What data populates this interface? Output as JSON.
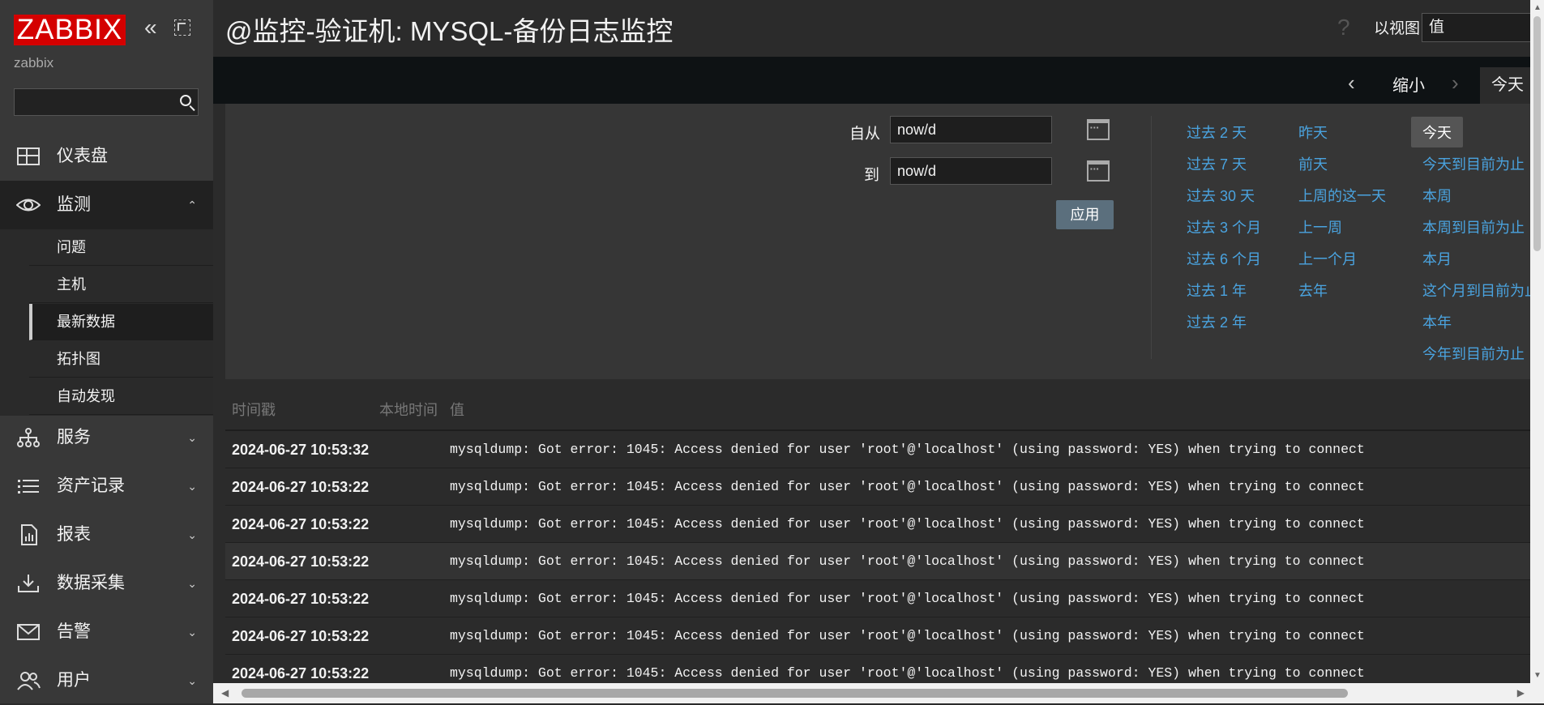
{
  "sidebar": {
    "logo": "ZABBIX",
    "server_name": "zabbix",
    "search_placeholder": "",
    "menu": [
      {
        "label": "仪表盘",
        "icon": "dashboard-icon"
      },
      {
        "label": "监测",
        "icon": "eye-icon",
        "expanded": true
      },
      {
        "label": "服务",
        "icon": "services-icon"
      },
      {
        "label": "资产记录",
        "icon": "list-icon"
      },
      {
        "label": "报表",
        "icon": "report-icon"
      },
      {
        "label": "数据采集",
        "icon": "download-icon"
      },
      {
        "label": "告警",
        "icon": "mail-icon"
      },
      {
        "label": "用户",
        "icon": "users-icon"
      }
    ],
    "submenu": [
      "问题",
      "主机",
      "最新数据",
      "拓扑图",
      "自动发现"
    ],
    "submenu_selected": "最新数据"
  },
  "header": {
    "title": "@监控-验证机: MYSQL-备份日志监控",
    "view_as_label": "以视图",
    "view_as_value": "值"
  },
  "filter_tabs": {
    "zoom_out": "缩小",
    "active_tab": "今天"
  },
  "filter": {
    "from_label": "自从",
    "from_value": "now/d",
    "to_label": "到",
    "to_value": "now/d",
    "apply_label": "应用",
    "quick_col1": [
      "过去 2 天",
      "过去 7 天",
      "过去 30 天",
      "过去 3 个月",
      "过去 6 个月",
      "过去 1 年",
      "过去 2 年"
    ],
    "quick_col2": [
      "昨天",
      "前天",
      "上周的这一天",
      "上一周",
      "上一个月",
      "去年"
    ],
    "quick_col3": [
      "今天",
      "今天到目前为止",
      "本周",
      "本周到目前为止",
      "本月",
      "这个月到目前为止",
      "本年",
      "今年到目前为止"
    ]
  },
  "table": {
    "headers": [
      "时间戳",
      "本地时间",
      "值"
    ],
    "rows": [
      {
        "timestamp": "2024-06-27 10:53:32",
        "value": "mysqldump: Got error: 1045: Access denied for user 'root'@'localhost' (using password: YES) when trying to connect"
      },
      {
        "timestamp": "2024-06-27 10:53:22",
        "value": "mysqldump: Got error: 1045: Access denied for user 'root'@'localhost' (using password: YES) when trying to connect"
      },
      {
        "timestamp": "2024-06-27 10:53:22",
        "value": "mysqldump: Got error: 1045: Access denied for user 'root'@'localhost' (using password: YES) when trying to connect"
      },
      {
        "timestamp": "2024-06-27 10:53:22",
        "value": "mysqldump: Got error: 1045: Access denied for user 'root'@'localhost' (using password: YES) when trying to connect"
      },
      {
        "timestamp": "2024-06-27 10:53:22",
        "value": "mysqldump: Got error: 1045: Access denied for user 'root'@'localhost' (using password: YES) when trying to connect"
      },
      {
        "timestamp": "2024-06-27 10:53:22",
        "value": "mysqldump: Got error: 1045: Access denied for user 'root'@'localhost' (using password: YES) when trying to connect"
      },
      {
        "timestamp": "2024-06-27 10:53:22",
        "value": "mysqldump: Got error: 1045: Access denied for user 'root'@'localhost' (using password: YES) when trying to connect"
      }
    ]
  },
  "colors": {
    "brand": "#d40000",
    "link": "#4aa3df",
    "apply_button": "#5b6f7d",
    "background": "#2b2b2b"
  }
}
